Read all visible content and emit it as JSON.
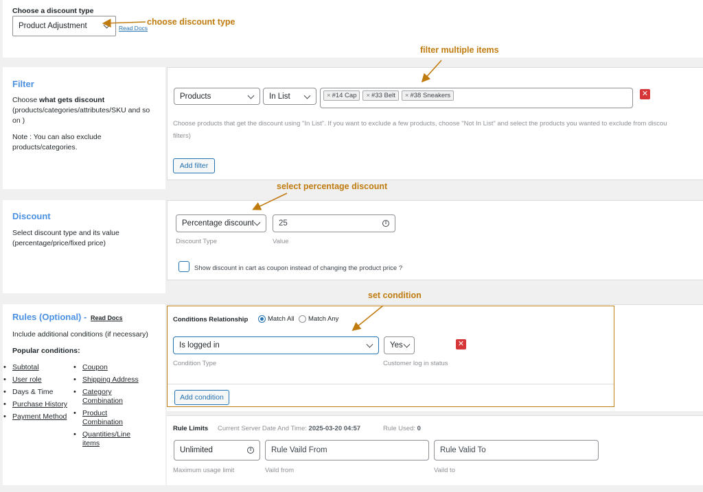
{
  "discount_type": {
    "label": "Choose a discount type",
    "selected": "Product Adjustment",
    "read_docs": "Read Docs",
    "annotation": "choose discount type"
  },
  "filter": {
    "title": "Filter",
    "desc_prefix": "Choose ",
    "desc_bold": "what gets discount",
    "desc_rest": "(products/categories/attributes/SKU and so on )",
    "note": "Note : You can also exclude products/categories.",
    "type_select": "Products",
    "op_select": "In List",
    "tags": [
      "#14 Cap",
      "#33 Belt",
      "#38 Sneakers"
    ],
    "tag_remove": "×",
    "help_line1": "Choose products that get the discount using \"In List\". If you want to exclude a few products, choose \"Not In List\" and select the products you wanted to exclude from discou",
    "help_line2": "filters)",
    "add_button": "Add filter",
    "remove_glyph": "✕",
    "annotation": "filter multiple items"
  },
  "discount": {
    "title": "Discount",
    "desc": "Select discount type and its value (percentage/price/fixed price)",
    "type_select": "Percentage discount",
    "type_label": "Discount Type",
    "value": "25",
    "value_label": "Value",
    "coupon_checkbox_label": "Show discount in cart as coupon instead of changing the product price ?",
    "annotation": "select percentage discount"
  },
  "rules": {
    "title": "Rules (Optional) -",
    "read_docs": "Read Docs",
    "desc": "Include additional conditions (if necessary)",
    "popular_heading": "Popular conditions:",
    "conditions_left": [
      "Subtotal",
      "User role",
      "Days & Time",
      "Purchase History",
      "Payment Method"
    ],
    "conditions_left_linked": [
      true,
      true,
      false,
      true,
      true
    ],
    "conditions_right": [
      "Coupon",
      "Shipping Address",
      "Category Combination",
      "Product Combination",
      "Quantities/Line items"
    ],
    "relationship_label": "Conditions Relationship",
    "match_all": "Match All",
    "match_any": "Match Any",
    "condition_select": "Is logged in",
    "condition_type_label": "Condition Type",
    "status_select": "Yes",
    "status_label": "Customer log in status",
    "add_button": "Add condition",
    "remove_glyph": "✕",
    "annotation": "set condition"
  },
  "limits": {
    "title": "Rule Limits",
    "server_time_label": "Current Server Date And Time:",
    "server_time": "2025-03-20 04:57",
    "used_label": "Rule Used:",
    "used": "0",
    "usage_select": "Unlimited",
    "usage_label": "Maximum usage limit",
    "from_placeholder": "Rule Vaild From",
    "from_label": "Vaild from",
    "to_placeholder": "Rule Valid To",
    "to_label": "Vaild to"
  },
  "colors": {
    "accent": "#2271b1",
    "section_title": "#4a90e2",
    "annotation": "#c07b0e",
    "remove": "#d63638"
  }
}
